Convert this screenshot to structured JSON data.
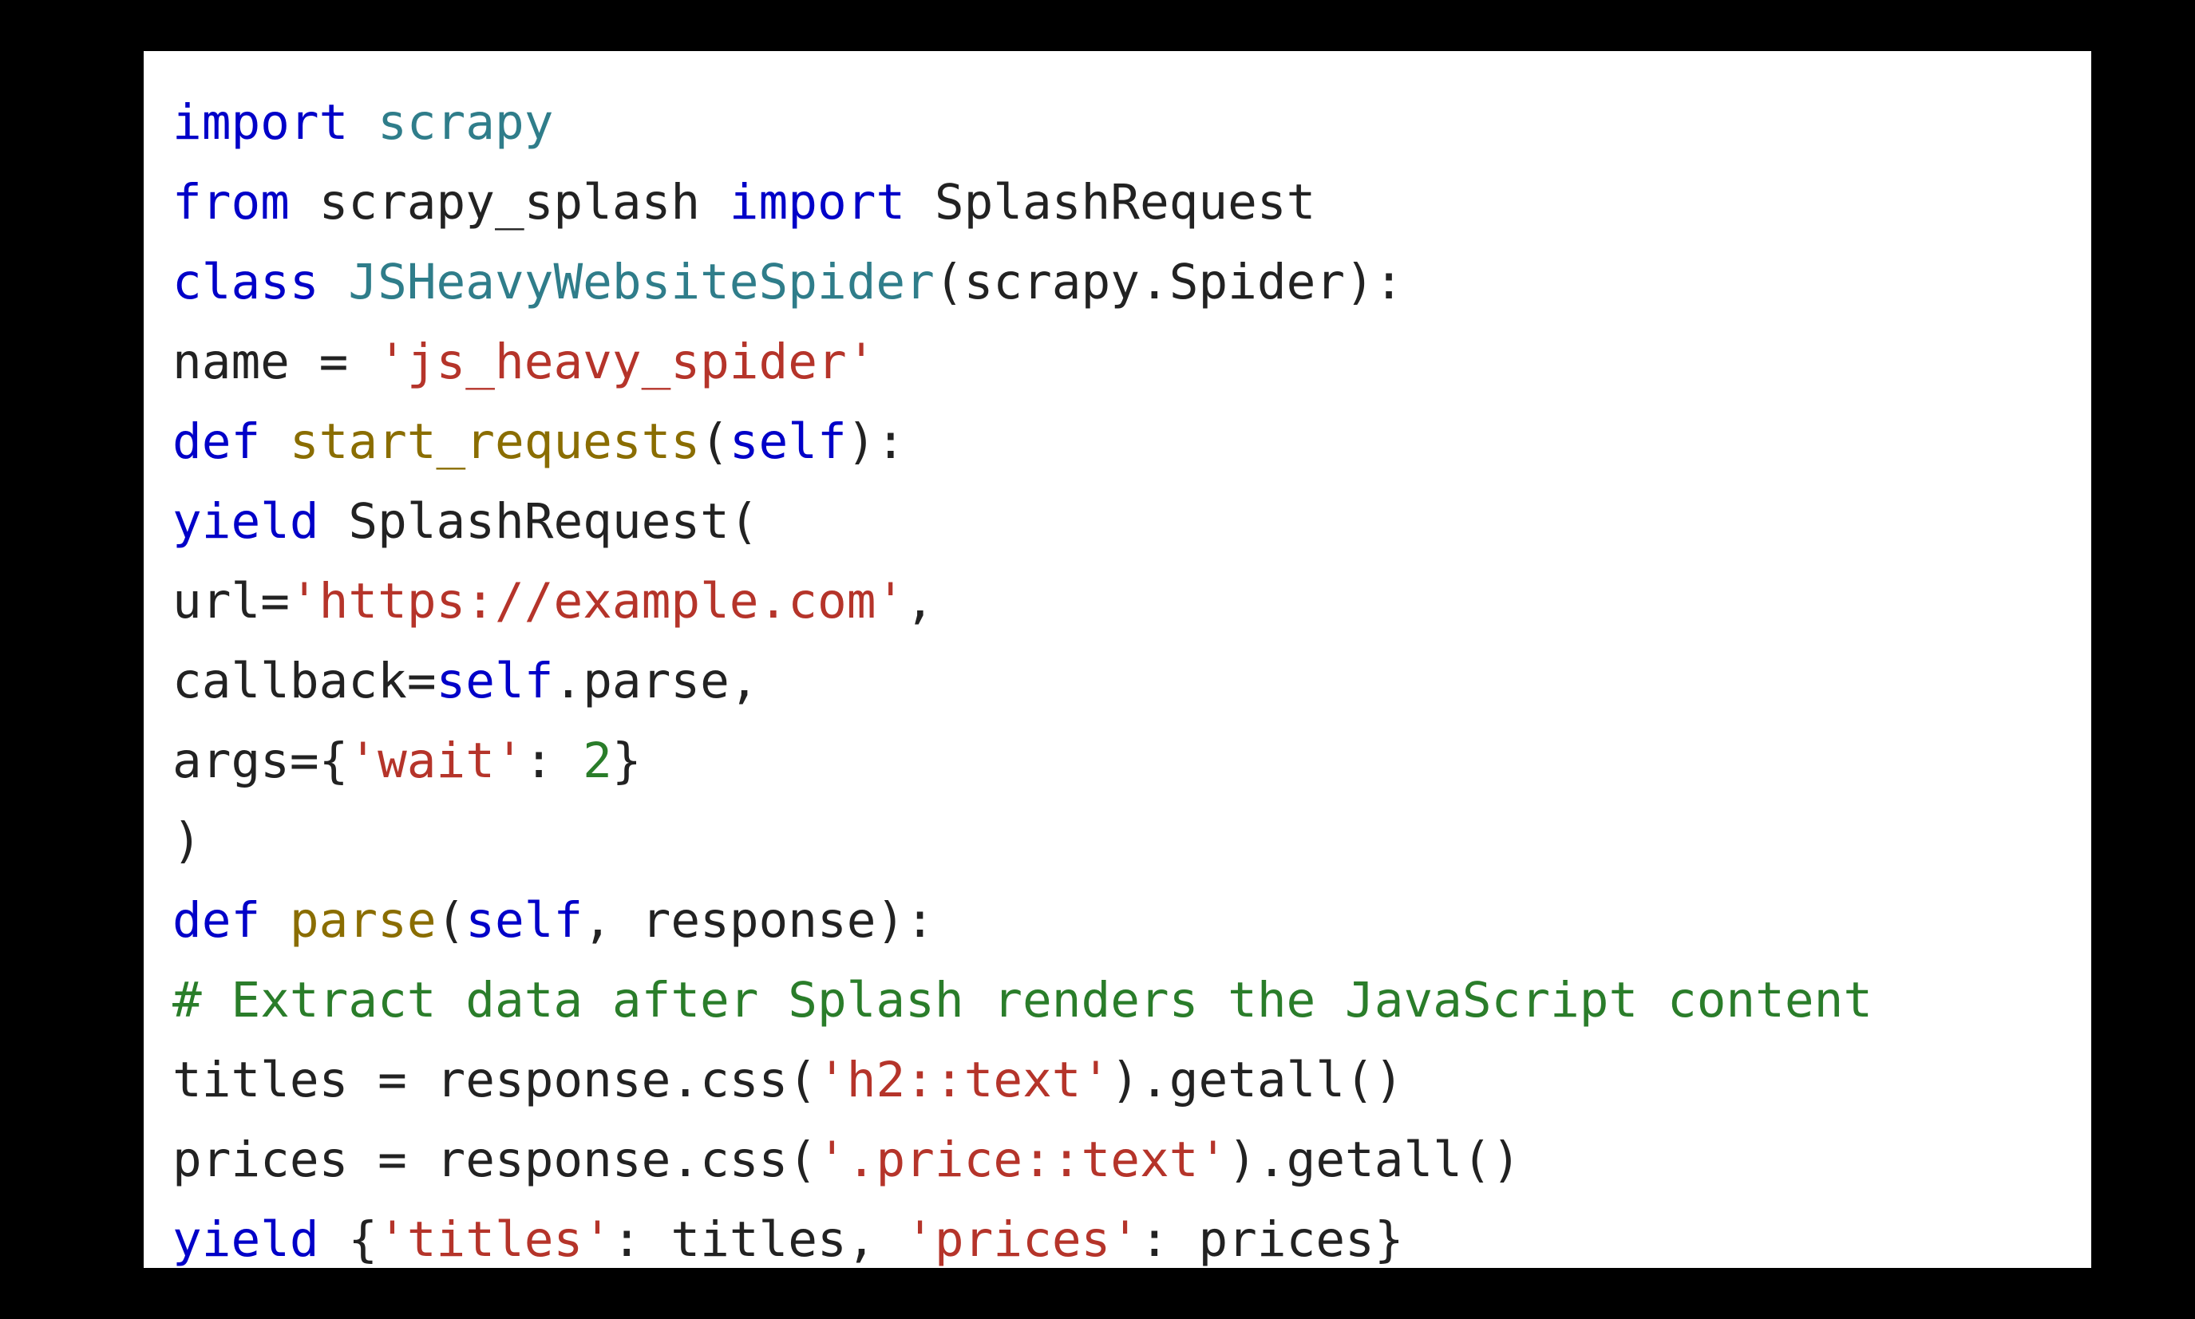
{
  "code": {
    "lines": [
      {
        "tokens": [
          {
            "cls": "kw",
            "t": "import"
          },
          {
            "cls": "id",
            "t": " "
          },
          {
            "cls": "mod",
            "t": "scrapy"
          }
        ]
      },
      {
        "tokens": [
          {
            "cls": "kw",
            "t": "from"
          },
          {
            "cls": "id",
            "t": " scrapy_splash "
          },
          {
            "cls": "kw",
            "t": "import"
          },
          {
            "cls": "id",
            "t": " SplashRequest"
          }
        ]
      },
      {
        "tokens": [
          {
            "cls": "kw",
            "t": "class"
          },
          {
            "cls": "id",
            "t": " "
          },
          {
            "cls": "cls",
            "t": "JSHeavyWebsiteSpider"
          },
          {
            "cls": "punct",
            "t": "("
          },
          {
            "cls": "id",
            "t": "scrapy"
          },
          {
            "cls": "punct",
            "t": "."
          },
          {
            "cls": "id",
            "t": "Spider"
          },
          {
            "cls": "punct",
            "t": "):"
          }
        ]
      },
      {
        "tokens": [
          {
            "cls": "id",
            "t": "name "
          },
          {
            "cls": "punct",
            "t": "= "
          },
          {
            "cls": "str",
            "t": "'js_heavy_spider'"
          }
        ]
      },
      {
        "tokens": [
          {
            "cls": "kw",
            "t": "def"
          },
          {
            "cls": "id",
            "t": " "
          },
          {
            "cls": "fn",
            "t": "start_requests"
          },
          {
            "cls": "punct",
            "t": "("
          },
          {
            "cls": "self",
            "t": "self"
          },
          {
            "cls": "punct",
            "t": "):"
          }
        ]
      },
      {
        "tokens": [
          {
            "cls": "kw",
            "t": "yield"
          },
          {
            "cls": "id",
            "t": " SplashRequest"
          },
          {
            "cls": "punct",
            "t": "("
          }
        ]
      },
      {
        "tokens": [
          {
            "cls": "id",
            "t": "url"
          },
          {
            "cls": "punct",
            "t": "="
          },
          {
            "cls": "str",
            "t": "'https://example.com'"
          },
          {
            "cls": "punct",
            "t": ","
          }
        ]
      },
      {
        "tokens": [
          {
            "cls": "id",
            "t": "callback"
          },
          {
            "cls": "punct",
            "t": "="
          },
          {
            "cls": "self",
            "t": "self"
          },
          {
            "cls": "punct",
            "t": "."
          },
          {
            "cls": "id",
            "t": "parse"
          },
          {
            "cls": "punct",
            "t": ","
          }
        ]
      },
      {
        "tokens": [
          {
            "cls": "id",
            "t": "args"
          },
          {
            "cls": "punct",
            "t": "={"
          },
          {
            "cls": "str",
            "t": "'wait'"
          },
          {
            "cls": "punct",
            "t": ": "
          },
          {
            "cls": "num",
            "t": "2"
          },
          {
            "cls": "punct",
            "t": "}"
          }
        ]
      },
      {
        "tokens": [
          {
            "cls": "punct",
            "t": ")"
          }
        ]
      },
      {
        "tokens": [
          {
            "cls": "kw",
            "t": "def"
          },
          {
            "cls": "id",
            "t": " "
          },
          {
            "cls": "fn",
            "t": "parse"
          },
          {
            "cls": "punct",
            "t": "("
          },
          {
            "cls": "self",
            "t": "self"
          },
          {
            "cls": "punct",
            "t": ", "
          },
          {
            "cls": "id",
            "t": "response"
          },
          {
            "cls": "punct",
            "t": "):"
          }
        ]
      },
      {
        "tokens": [
          {
            "cls": "cmt",
            "t": "# Extract data after Splash renders the JavaScript content"
          }
        ]
      },
      {
        "tokens": [
          {
            "cls": "id",
            "t": "titles "
          },
          {
            "cls": "punct",
            "t": "= "
          },
          {
            "cls": "id",
            "t": "response"
          },
          {
            "cls": "punct",
            "t": "."
          },
          {
            "cls": "id",
            "t": "css"
          },
          {
            "cls": "punct",
            "t": "("
          },
          {
            "cls": "str",
            "t": "'h2::text'"
          },
          {
            "cls": "punct",
            "t": ")."
          },
          {
            "cls": "id",
            "t": "getall"
          },
          {
            "cls": "punct",
            "t": "()"
          }
        ]
      },
      {
        "tokens": [
          {
            "cls": "id",
            "t": "prices "
          },
          {
            "cls": "punct",
            "t": "= "
          },
          {
            "cls": "id",
            "t": "response"
          },
          {
            "cls": "punct",
            "t": "."
          },
          {
            "cls": "id",
            "t": "css"
          },
          {
            "cls": "punct",
            "t": "("
          },
          {
            "cls": "str",
            "t": "'.price::text'"
          },
          {
            "cls": "punct",
            "t": ")."
          },
          {
            "cls": "id",
            "t": "getall"
          },
          {
            "cls": "punct",
            "t": "()"
          }
        ]
      },
      {
        "tokens": [
          {
            "cls": "kw",
            "t": "yield"
          },
          {
            "cls": "id",
            "t": " "
          },
          {
            "cls": "punct",
            "t": "{"
          },
          {
            "cls": "str",
            "t": "'titles'"
          },
          {
            "cls": "punct",
            "t": ": "
          },
          {
            "cls": "id",
            "t": "titles"
          },
          {
            "cls": "punct",
            "t": ", "
          },
          {
            "cls": "str",
            "t": "'prices'"
          },
          {
            "cls": "punct",
            "t": ": "
          },
          {
            "cls": "id",
            "t": "prices"
          },
          {
            "cls": "punct",
            "t": "}"
          }
        ]
      }
    ]
  }
}
